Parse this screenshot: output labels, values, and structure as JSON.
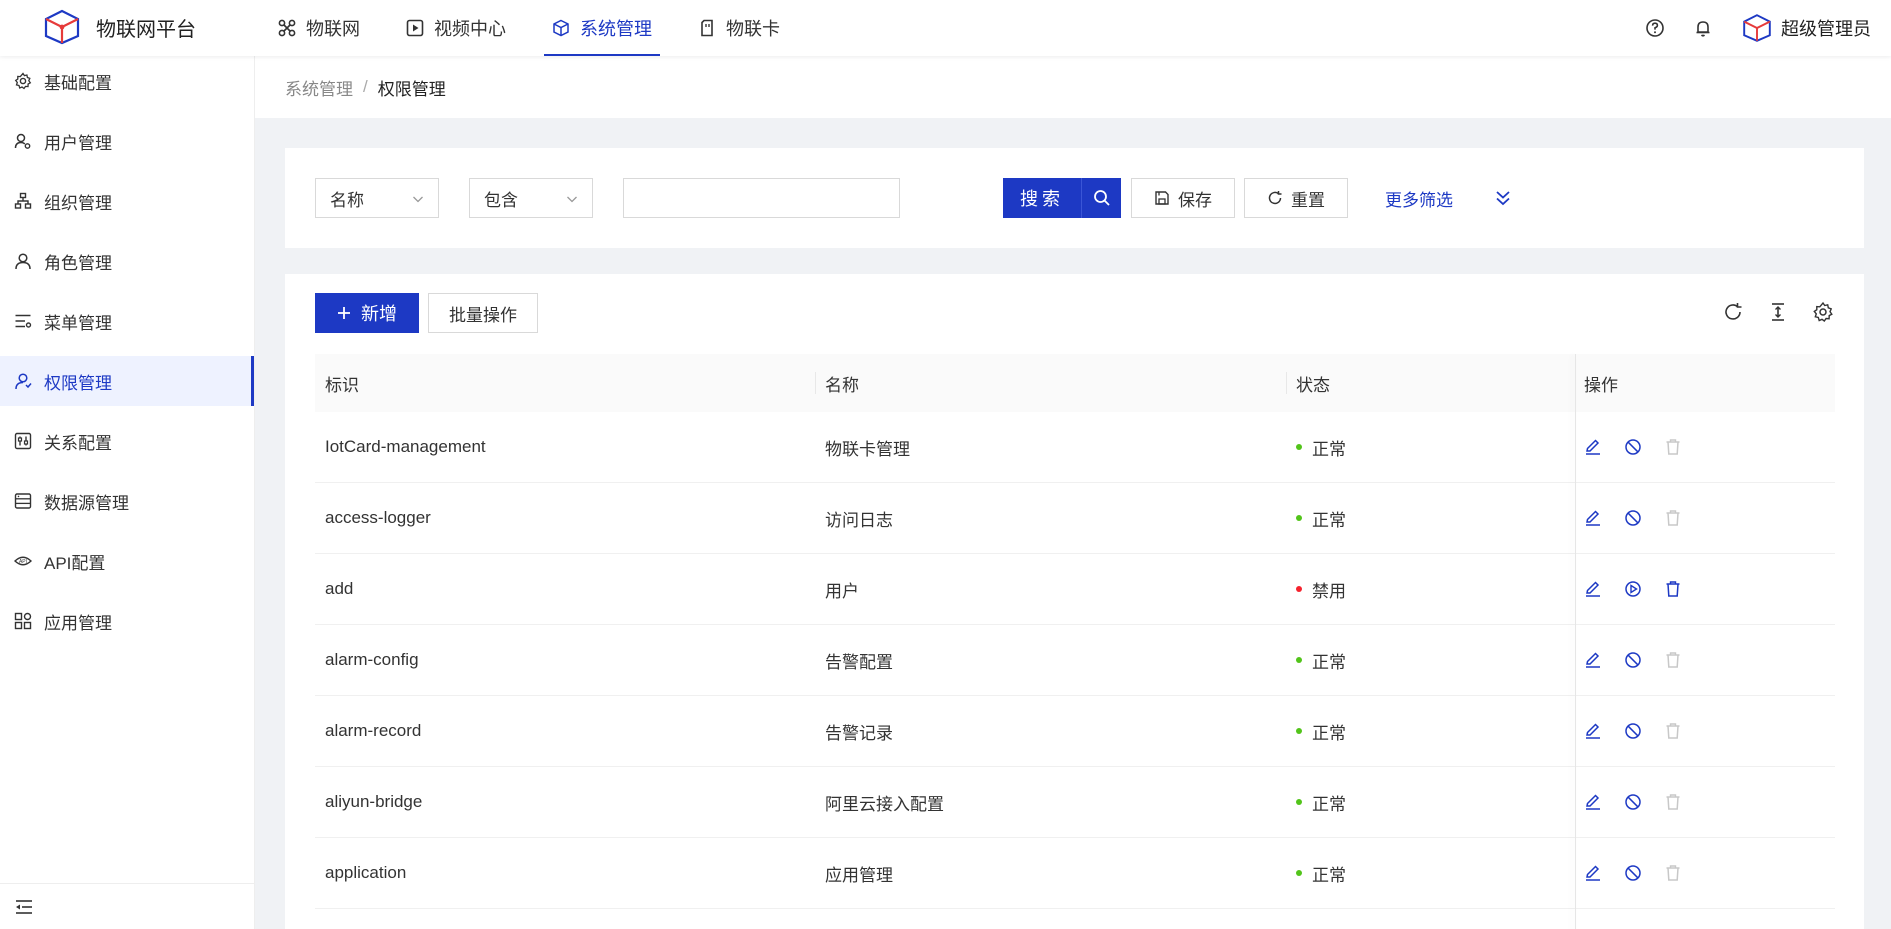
{
  "app": {
    "title": "物联网平台"
  },
  "topnav": [
    {
      "label": "物联网",
      "icon": "iot-icon"
    },
    {
      "label": "视频中心",
      "icon": "video-icon"
    },
    {
      "label": "系统管理",
      "icon": "system-icon",
      "active": true
    },
    {
      "label": "物联卡",
      "icon": "sim-card-icon"
    }
  ],
  "user": {
    "name": "超级管理员"
  },
  "sidebar": {
    "items": [
      {
        "label": "基础配置",
        "icon": "gear-icon"
      },
      {
        "label": "用户管理",
        "icon": "user-manage-icon"
      },
      {
        "label": "组织管理",
        "icon": "org-tree-icon"
      },
      {
        "label": "角色管理",
        "icon": "role-icon"
      },
      {
        "label": "菜单管理",
        "icon": "menu-list-icon"
      },
      {
        "label": "权限管理",
        "icon": "permission-icon",
        "active": true
      },
      {
        "label": "关系配置",
        "icon": "relation-icon"
      },
      {
        "label": "数据源管理",
        "icon": "datasource-icon"
      },
      {
        "label": "API配置",
        "icon": "api-icon"
      },
      {
        "label": "应用管理",
        "icon": "app-grid-icon"
      }
    ]
  },
  "breadcrumb": {
    "parent": "系统管理",
    "separator": "/",
    "current": "权限管理"
  },
  "filter": {
    "field_select": "名称",
    "operator_select": "包含",
    "value_input": "",
    "search_label": "搜索",
    "save_label": "保存",
    "reset_label": "重置",
    "more_label": "更多筛选"
  },
  "toolbar": {
    "add_label": "新增",
    "batch_label": "批量操作"
  },
  "table": {
    "columns": [
      "标识",
      "名称",
      "状态",
      "操作"
    ],
    "rows": [
      {
        "id": "IotCard-management",
        "name": "物联卡管理",
        "status": "正常",
        "enabled": true
      },
      {
        "id": "access-logger",
        "name": "访问日志",
        "status": "正常",
        "enabled": true
      },
      {
        "id": "add",
        "name": "用户",
        "status": "禁用",
        "enabled": false
      },
      {
        "id": "alarm-config",
        "name": "告警配置",
        "status": "正常",
        "enabled": true
      },
      {
        "id": "alarm-record",
        "name": "告警记录",
        "status": "正常",
        "enabled": true
      },
      {
        "id": "aliyun-bridge",
        "name": "阿里云接入配置",
        "status": "正常",
        "enabled": true
      },
      {
        "id": "application",
        "name": "应用管理",
        "status": "正常",
        "enabled": true
      }
    ]
  },
  "colors": {
    "primary": "#1d39c4",
    "status_normal": "#52c41a",
    "status_disabled": "#f5222d",
    "disabled_icon": "#c8c8c8"
  }
}
